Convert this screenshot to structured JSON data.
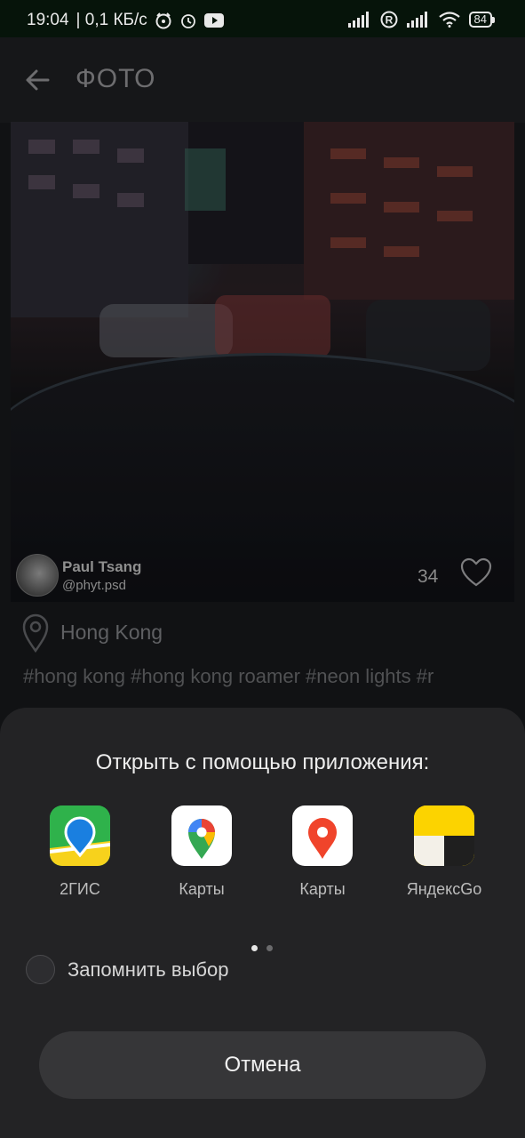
{
  "status_bar": {
    "time": "19:04",
    "speed": "| 0,1 КБ/с",
    "battery": "84",
    "icons": [
      "cat-icon",
      "alarm-icon",
      "youtube-icon",
      "signal-icon",
      "roaming-icon",
      "signal-icon",
      "wifi-icon",
      "battery-icon"
    ]
  },
  "app_bar": {
    "title": "ФОТО",
    "back_icon": "arrow-left-icon"
  },
  "photo": {
    "author_name": "Paul Tsang",
    "author_handle": "@phyt.psd",
    "likes": "34",
    "location": "Hong Kong",
    "tags": "#hong kong #hong kong roamer #neon lights #r"
  },
  "sheet": {
    "title": "Открыть с помощью приложения:",
    "apps": [
      {
        "label": "2ГИС",
        "icon": "2gis-icon"
      },
      {
        "label": "Карты",
        "icon": "google-maps-icon"
      },
      {
        "label": "Карты",
        "icon": "yandex-maps-icon"
      },
      {
        "label": "ЯндексGo",
        "icon": "yandex-go-icon"
      }
    ],
    "remember_label": "Запомнить выбор",
    "cancel_label": "Отмена"
  },
  "colors": {
    "sheet_bg": "#232325",
    "button_bg": "#363638",
    "status_bg": "#06140a"
  }
}
